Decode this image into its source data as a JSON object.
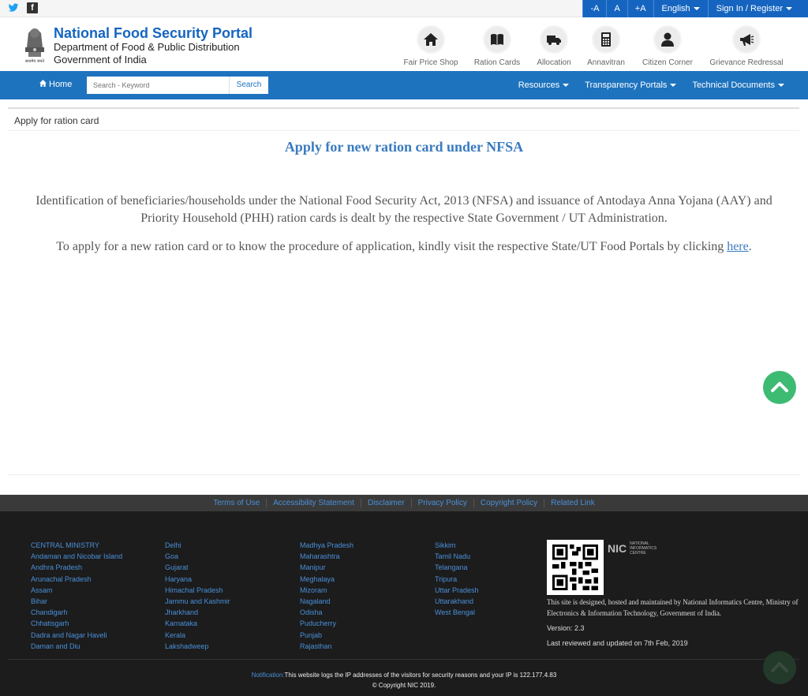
{
  "topbar": {
    "font_minus": "-A",
    "font_normal": "A",
    "font_plus": "+A",
    "language": "English",
    "signin": "Sign In / Register"
  },
  "header": {
    "title": "National Food Security Portal",
    "dept": "Department of Food & Public Distribution",
    "govt": "Government of India",
    "emblem_text": "सत्यमेव जयते",
    "icons": [
      {
        "label": "Fair Price Shop",
        "icon": "house-icon"
      },
      {
        "label": "Ration Cards",
        "icon": "book-icon"
      },
      {
        "label": "Allocation",
        "icon": "truck-icon"
      },
      {
        "label": "Annavitran",
        "icon": "calculator-icon"
      },
      {
        "label": "Citizen Corner",
        "icon": "user-icon"
      },
      {
        "label": "Grievance Redressal",
        "icon": "megaphone-icon"
      }
    ]
  },
  "nav": {
    "home": "Home",
    "search_placeholder": "Search - Keyword",
    "search_btn": "Search",
    "resources": "Resources",
    "transparency": "Transparency Portals",
    "technical": "Technical Documents"
  },
  "breadcrumb": "Apply for ration card",
  "main": {
    "title": "Apply for new ration card under NFSA",
    "para1": "Identification of beneficiaries/households under the National Food Security Act, 2013 (NFSA) and issuance of Antodaya Anna Yojana (AAY) and Priority Household (PHH) ration cards is dealt by the respective State Government / UT Administration.",
    "para2": "To apply for a new ration card or to know the procedure of application, kindly visit the respective State/UT Food Portals by clicking",
    "link": "here",
    "period": "."
  },
  "footer": {
    "links": [
      "Terms of Use",
      "Accessibility Statement",
      "Disclaimer",
      "Privacy Policy",
      "Copyright Policy",
      "Related Link"
    ],
    "col1": [
      "CENTRAL MINISTRY",
      "Andaman and Nicobar Island",
      "Andhra Pradesh",
      "Arunachal Pradesh",
      "Assam",
      "Bihar",
      "Chandigarh",
      "Chhatisgarh",
      "Dadra and Nagar Haveli",
      "Daman and Diu"
    ],
    "col2": [
      "Delhi",
      "Goa",
      "Gujarat",
      "Haryana",
      "Himachal Pradesh",
      "Jammu and Kashmir",
      "Jharkhand",
      "Karnataka",
      "Kerala",
      "Lakshadweep"
    ],
    "col3": [
      "Madhya Pradesh",
      "Maharashtra",
      "Manipur",
      "Meghalaya",
      "Mizoram",
      "Nagaland",
      "Odisha",
      "Puducherry",
      "Punjab",
      "Rajasthan"
    ],
    "col4": [
      "Sikkim",
      "Tamil Nadu",
      "Telangana",
      "Tripura",
      "Uttar Pradesh",
      "Uttarakhand",
      "West Bengal"
    ],
    "nic_mark": "NIC",
    "nic_name1": "NATIONAL",
    "nic_name2": "INFORMATICS",
    "nic_name3": "CENTRE",
    "designed": "This site is designed, hosted and maintained by National Informatics Centre, Ministry of Electronics & Information Technology, Government of India.",
    "version": "Version: 2.3",
    "updated": "Last reviewed and updated on 7th Feb, 2019",
    "notif_label": "Notification:",
    "notif_text": "This website logs the IP addresses of the visitors for security reasons and your IP is 122.177.4.83",
    "copyright": "© Copyright NIC 2019."
  }
}
